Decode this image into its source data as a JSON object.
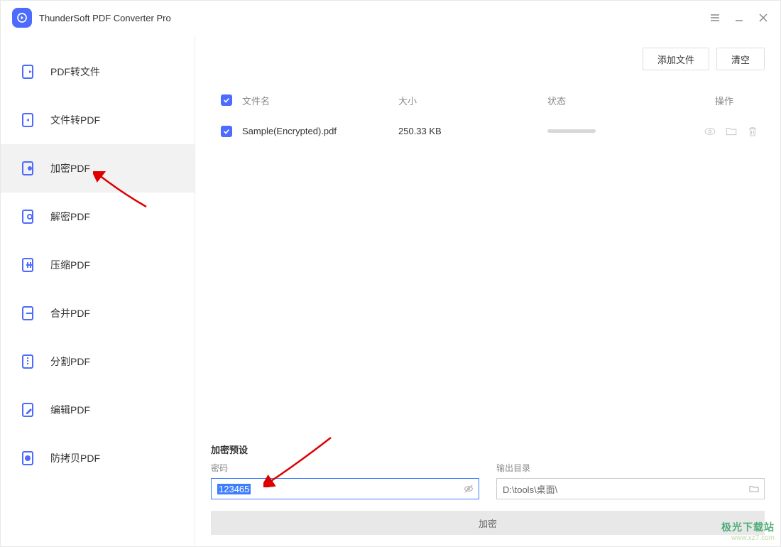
{
  "app_title": "ThunderSoft PDF Converter Pro",
  "sidebar": {
    "items": [
      {
        "label": "PDF转文件"
      },
      {
        "label": "文件转PDF"
      },
      {
        "label": "加密PDF"
      },
      {
        "label": "解密PDF"
      },
      {
        "label": "压缩PDF"
      },
      {
        "label": "合并PDF"
      },
      {
        "label": "分割PDF"
      },
      {
        "label": "编辑PDF"
      },
      {
        "label": "防拷贝PDF"
      }
    ]
  },
  "toolbar": {
    "add_file": "添加文件",
    "clear": "清空"
  },
  "table": {
    "header": {
      "filename": "文件名",
      "size": "大小",
      "status": "状态",
      "action": "操作"
    },
    "rows": [
      {
        "filename": "Sample(Encrypted).pdf",
        "size": "250.33 KB"
      }
    ]
  },
  "settings": {
    "title": "加密预设",
    "password_label": "密码",
    "password_value": "123465",
    "output_label": "输出目录",
    "output_value": "D:\\tools\\桌面\\"
  },
  "action": {
    "encrypt": "加密"
  },
  "watermark": {
    "main": "极光下载站",
    "sub": "www.xz7.com"
  }
}
